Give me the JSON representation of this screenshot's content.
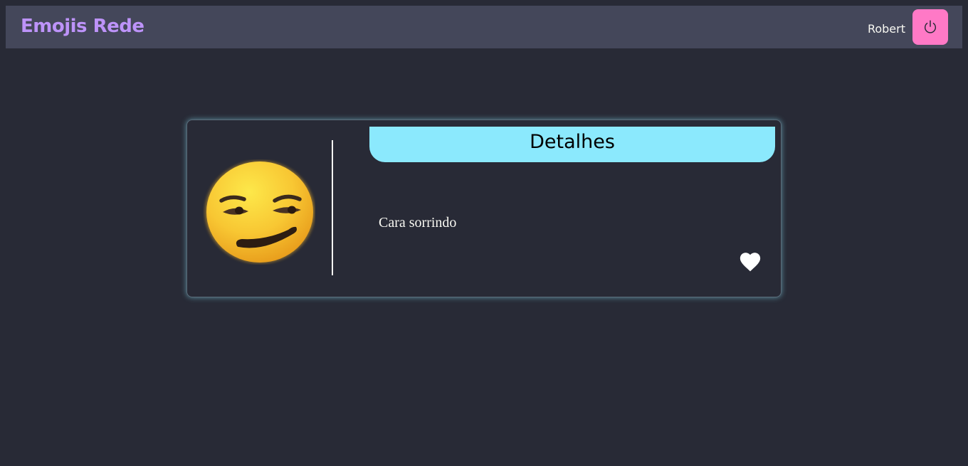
{
  "navbar": {
    "brand": "Emojis Rede",
    "username": "Robert",
    "logout_icon": "power-icon"
  },
  "card": {
    "emoji_icon": "smirking-face-emoji",
    "header": "Detalhes",
    "description": "Cara sorrindo",
    "favorite_icon": "heart-icon"
  },
  "colors": {
    "background": "#282a36",
    "navbar": "#44475a",
    "brand": "#bd93f9",
    "logout_button": "#ff79c6",
    "header": "#8be9fd",
    "text": "#f8f8f2"
  }
}
